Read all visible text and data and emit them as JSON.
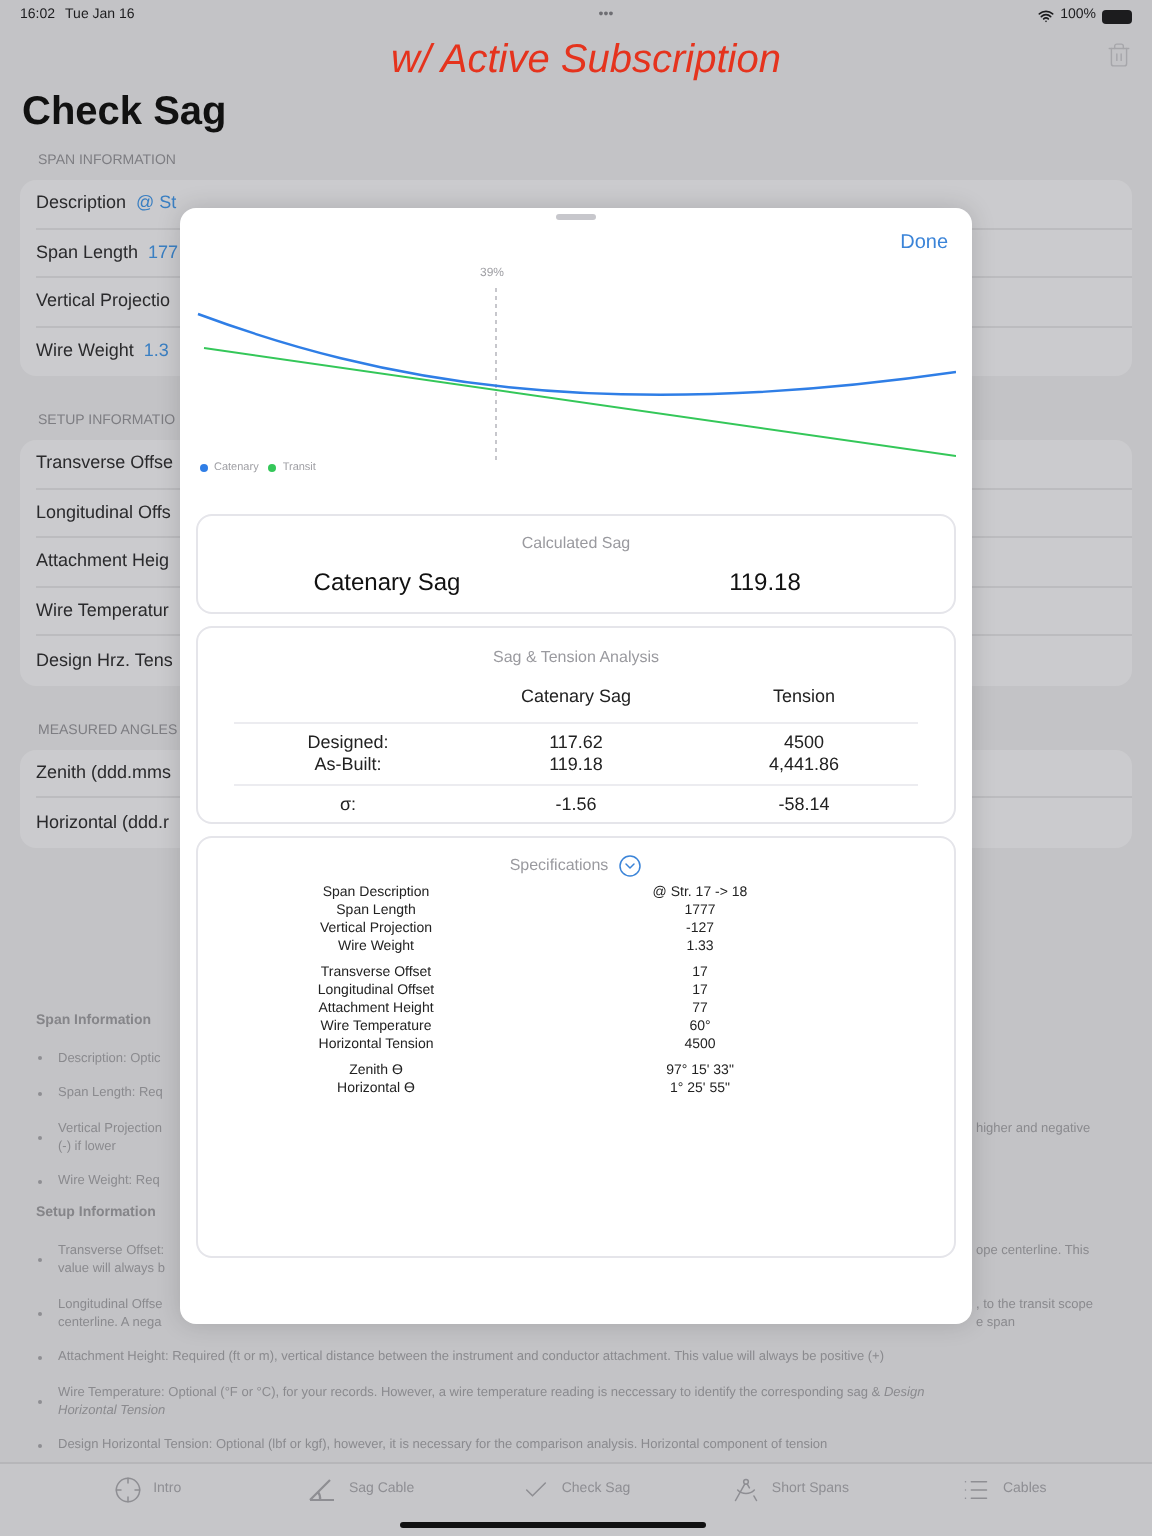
{
  "status_bar": {
    "time": "16:02",
    "date": "Tue Jan 16",
    "dots": "•••",
    "battery": "100%"
  },
  "banner": "w/ Active Subscription",
  "title": "Check Sag",
  "sections": [
    {
      "header": "SPAN INFORMATION",
      "rows": [
        {
          "label": "Description",
          "value": "@ St"
        },
        {
          "label": "Span Length",
          "value": "177"
        },
        {
          "label": "Vertical Projectio"
        },
        {
          "label": "Wire Weight",
          "value": "1.3"
        }
      ]
    },
    {
      "header": "SETUP INFORMATIO",
      "rows": [
        {
          "label": "Transverse Offse"
        },
        {
          "label": "Longitudinal Offs"
        },
        {
          "label": "Attachment Heig"
        },
        {
          "label": "Wire Temperatur"
        },
        {
          "label": "Design Hrz. Tens"
        }
      ]
    },
    {
      "header": "MEASURED ANGLES",
      "rows": [
        {
          "label": "Zenith (ddd.mms"
        },
        {
          "label": "Horizontal (ddd.r"
        }
      ]
    }
  ],
  "help": [
    {
      "heading": "Span Information",
      "items": [
        {
          "lines": [
            {
              "start": "Description:  Optic"
            }
          ]
        },
        {
          "lines": [
            {
              "start": "Span Length:  Req"
            }
          ]
        },
        {
          "lines": [
            {
              "start": "Vertical Projection",
              "end": "higher and negative"
            },
            {
              "start": "(-) if lower"
            }
          ]
        },
        {
          "lines": [
            {
              "start": "Wire Weight:  Req"
            }
          ]
        }
      ]
    },
    {
      "heading": "Setup Information",
      "items": [
        {
          "lines": [
            {
              "start": "Transverse Offset:",
              "end": "ope centerline. This"
            },
            {
              "start": "value will always b"
            }
          ]
        },
        {
          "lines": [
            {
              "start": "Longitudinal Offse",
              "end": ", to the transit scope"
            },
            {
              "start": "centerline. A nega",
              "end": "e span"
            }
          ]
        },
        {
          "lines": [
            {
              "start": "Attachment Height:  Required (ft or m), vertical distance between the instrument and conductor attachment. This value will always be positive (+)"
            }
          ]
        },
        {
          "lines": [
            {
              "start": "Wire Temperature:  Optional (°F or °C), for your records. However, a wire temperature reading is neccessary to identify the corresponding sag & *Design*"
            },
            {
              "start": "*Horizontal Tension*"
            }
          ]
        },
        {
          "lines": [
            {
              "start": "Design Horizontal Tension:  Optional (lbf or kgf), however, it is necessary for the comparison analysis. Horizontal component of tension"
            }
          ]
        }
      ]
    }
  ],
  "tabs": [
    {
      "label": "Intro"
    },
    {
      "label": "Sag Cable"
    },
    {
      "label": "Check Sag"
    },
    {
      "label": "Short Spans"
    },
    {
      "label": "Cables"
    }
  ],
  "modal": {
    "done": "Done",
    "chart": {
      "marker_label": "39%",
      "legend": [
        {
          "name": "Catenary",
          "color": "#2f7ee6"
        },
        {
          "name": "Transit",
          "color": "#34c759"
        }
      ]
    },
    "calculated": {
      "title": "Calculated Sag",
      "label": "Catenary Sag",
      "value": "119.18"
    },
    "analysis": {
      "title": "Sag & Tension Analysis",
      "columns": [
        "Catenary Sag",
        "Tension"
      ],
      "groups": [
        [
          {
            "label": "Designed:",
            "values": [
              "117.62",
              "4500"
            ]
          },
          {
            "label": "As-Built:",
            "values": [
              "119.18",
              "4,441.86"
            ]
          }
        ],
        [
          {
            "label": "σ:",
            "values": [
              "-1.56",
              "-58.14"
            ]
          }
        ]
      ]
    },
    "specifications": {
      "title": "Specifications",
      "expanded": true,
      "groups": [
        [
          {
            "label": "Span Description",
            "value": "@ Str. 17 -> 18"
          },
          {
            "label": "Span Length",
            "value": "1777"
          },
          {
            "label": "Vertical Projection",
            "value": "-127"
          },
          {
            "label": "Wire Weight",
            "value": "1.33"
          }
        ],
        [
          {
            "label": "Transverse Offset",
            "value": "17"
          },
          {
            "label": "Longitudinal Offset",
            "value": "17"
          },
          {
            "label": "Attachment Height",
            "value": "77"
          },
          {
            "label": "Wire Temperature",
            "value": "60°"
          },
          {
            "label": "Horizontal Tension",
            "value": "4500"
          }
        ],
        [
          {
            "label": "Zenith ϴ",
            "value": "97° 15' 33\""
          },
          {
            "label": "Horizontal ϴ",
            "value": "1° 25' 55\""
          }
        ]
      ]
    }
  }
}
